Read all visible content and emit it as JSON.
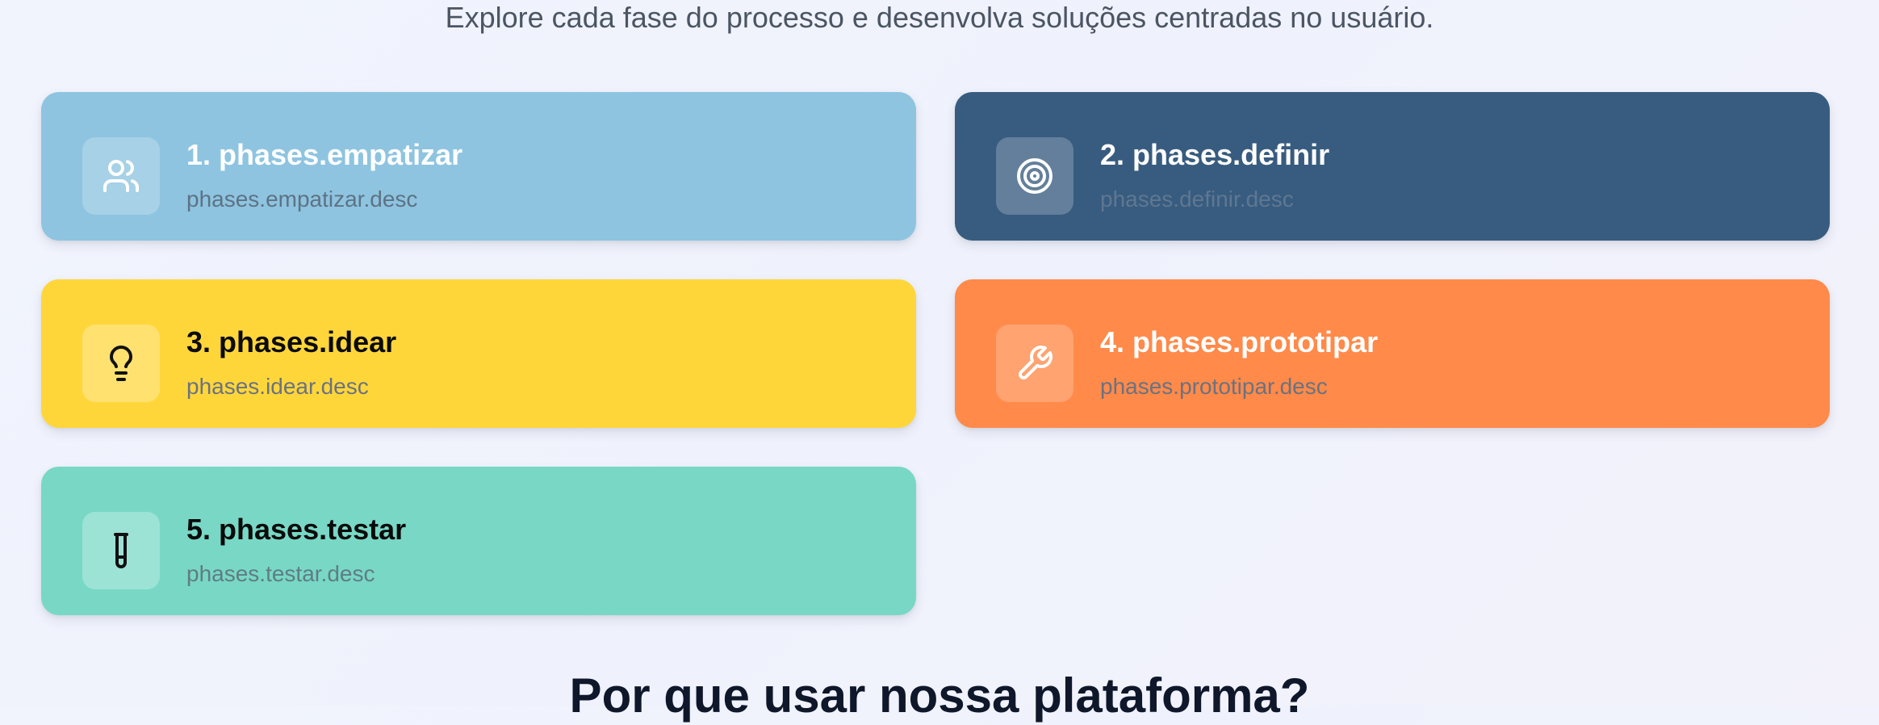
{
  "intro": {
    "subtitle": "Explore cada fase do processo e desenvolva soluções centradas no usuário."
  },
  "phases": [
    {
      "title": "1. phases.empatizar",
      "desc": "phases.empatizar.desc",
      "icon": "users-icon",
      "color": "#8ec4e0"
    },
    {
      "title": "2. phases.definir",
      "desc": "phases.definir.desc",
      "icon": "target-icon",
      "color": "#385c7f"
    },
    {
      "title": "3. phases.idear",
      "desc": "phases.idear.desc",
      "icon": "lightbulb-icon",
      "color": "#ffd63a"
    },
    {
      "title": "4. phases.prototipar",
      "desc": "phases.prototipar.desc",
      "icon": "wrench-icon",
      "color": "#ff8a4a"
    },
    {
      "title": "5. phases.testar",
      "desc": "phases.testar.desc",
      "icon": "test-tube-icon",
      "color": "#78d8c5"
    }
  ],
  "next_section": {
    "heading": "Por que usar nossa plataforma?"
  }
}
